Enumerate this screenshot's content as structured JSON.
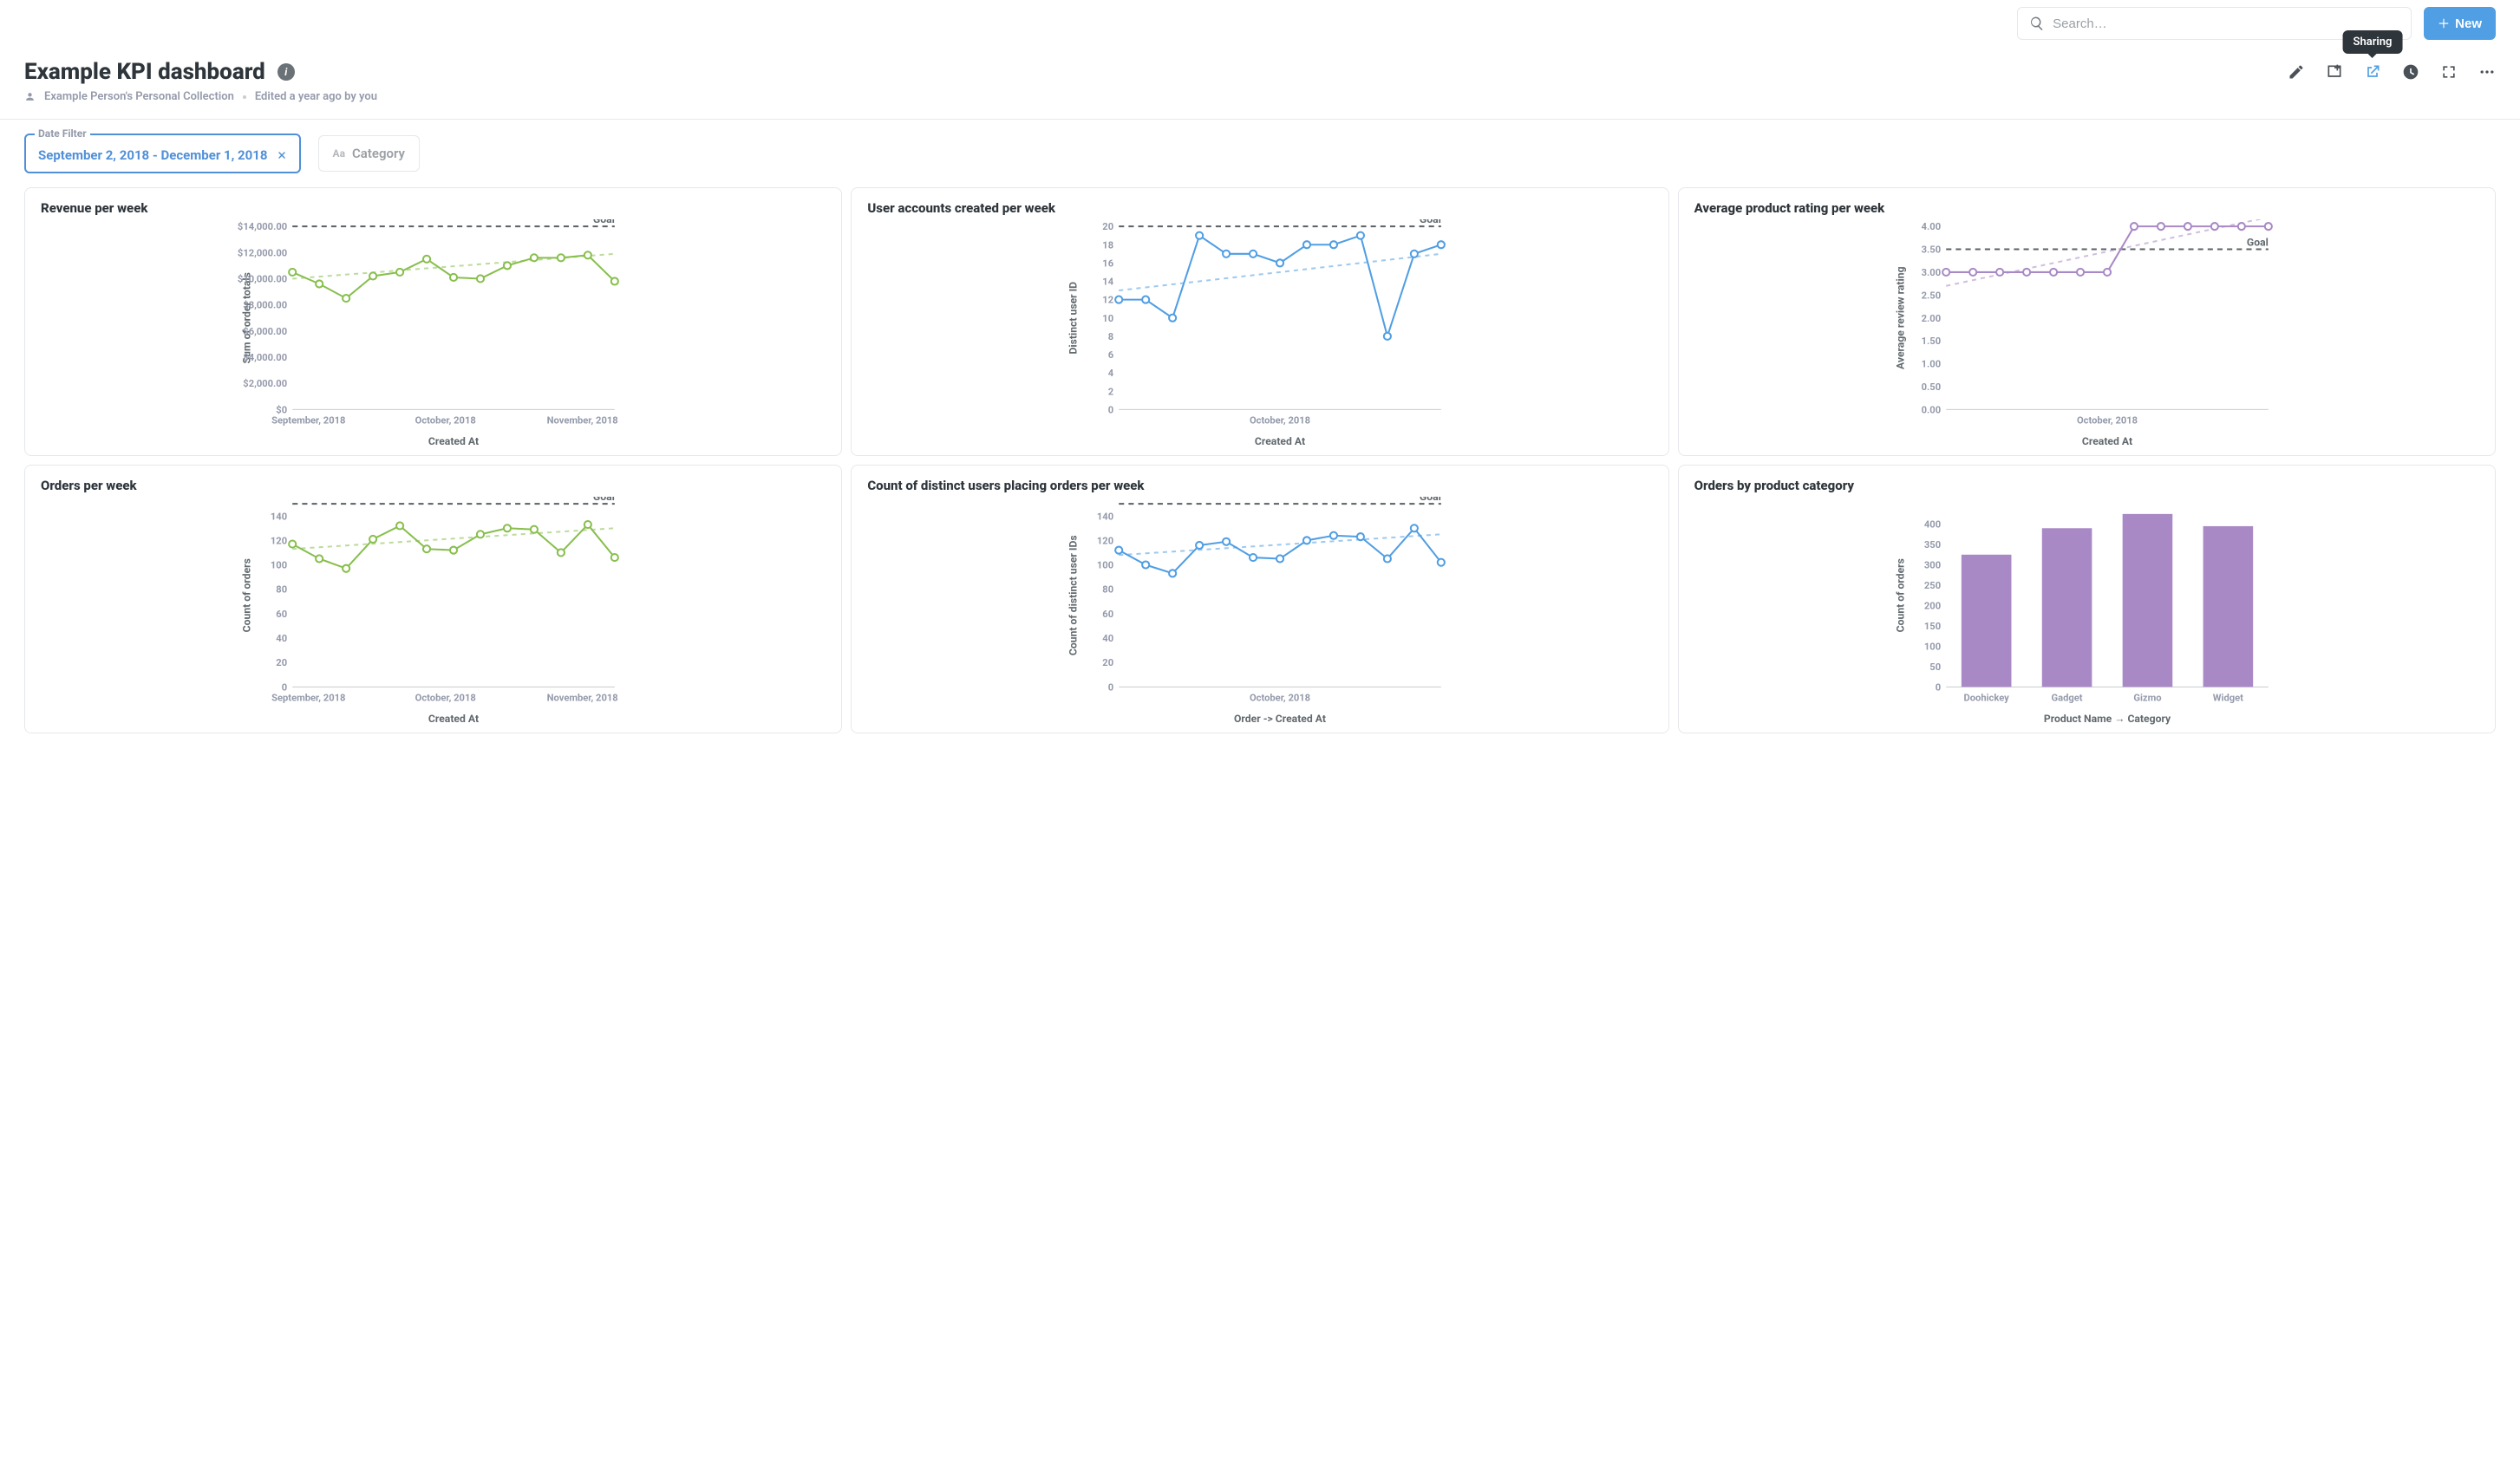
{
  "topbar": {
    "search_placeholder": "Search…",
    "new_label": "New"
  },
  "header": {
    "title": "Example KPI dashboard",
    "collection": "Example Person's Personal Collection",
    "edited": "Edited a year ago by you",
    "tooltip": "Sharing"
  },
  "filters": {
    "date_legend": "Date Filter",
    "date_value": "September 2, 2018 - December 1, 2018",
    "category_label": "Category"
  },
  "cards": [
    {
      "title": "Revenue per week",
      "xlabel": "Created At",
      "ylabel": "Sum of order totals",
      "goal": "Goal"
    },
    {
      "title": "User accounts created per week",
      "xlabel": "Created At",
      "ylabel": "Distinct user ID",
      "goal": "Goal"
    },
    {
      "title": "Average product rating per week",
      "xlabel": "Created At",
      "ylabel": "Average review rating",
      "goal": "Goal"
    },
    {
      "title": "Orders per week",
      "xlabel": "Created At",
      "ylabel": "Count of orders",
      "goal": "Goal"
    },
    {
      "title": "Count of distinct users placing orders per week",
      "xlabel": "Order -> Created At",
      "ylabel": "Count of distinct user IDs",
      "goal": "Goal"
    },
    {
      "title": "Orders by product category",
      "xlabel": "Product Name → Category",
      "ylabel": "Count of orders"
    }
  ],
  "chart_data": [
    {
      "type": "line",
      "color": "#88bf4d",
      "title": "Revenue per week",
      "xlabel": "Created At",
      "ylabel": "Sum of order totals",
      "ylim": [
        0,
        14000
      ],
      "goal": 14000,
      "yticks": [
        0,
        2000,
        4000,
        6000,
        8000,
        10000,
        12000,
        14000
      ],
      "ytick_labels": [
        "$0",
        "$2,000.00",
        "$4,000.00",
        "$6,000.00",
        "$8,000.00",
        "$10,000.00",
        "$12,000.00",
        "$14,000.00"
      ],
      "xticks": [
        "September, 2018",
        "October, 2018",
        "November, 2018"
      ],
      "x": [
        0,
        1,
        2,
        3,
        4,
        5,
        6,
        7,
        8,
        9,
        10,
        11,
        12
      ],
      "y": [
        10500,
        9600,
        8500,
        10200,
        10500,
        11500,
        10100,
        10000,
        11000,
        11600,
        11600,
        11800,
        9800
      ],
      "trend": [
        10000,
        11900
      ]
    },
    {
      "type": "line",
      "color": "#509ee3",
      "title": "User accounts created per week",
      "xlabel": "Created At",
      "ylabel": "Distinct user ID",
      "ylim": [
        0,
        20
      ],
      "goal": 20,
      "yticks": [
        0,
        2,
        4,
        6,
        8,
        10,
        12,
        14,
        16,
        18,
        20
      ],
      "ytick_labels": [
        "0",
        "2",
        "4",
        "6",
        "8",
        "10",
        "12",
        "14",
        "16",
        "18",
        "20"
      ],
      "xticks": [
        "October, 2018"
      ],
      "x": [
        0,
        1,
        2,
        3,
        4,
        5,
        6,
        7,
        8,
        9,
        10,
        11,
        12
      ],
      "y": [
        12,
        12,
        10,
        19,
        17,
        17,
        16,
        18,
        18,
        19,
        8,
        17,
        18
      ],
      "trend": [
        13,
        17
      ]
    },
    {
      "type": "line",
      "color": "#a989c5",
      "title": "Average product rating per week",
      "xlabel": "Created At",
      "ylabel": "Average review rating",
      "ylim": [
        0,
        4.0
      ],
      "goal": 3.5,
      "yticks": [
        0,
        0.5,
        1.0,
        1.5,
        2.0,
        2.5,
        3.0,
        3.5,
        4.0
      ],
      "ytick_labels": [
        "0.00",
        "0.50",
        "1.00",
        "1.50",
        "2.00",
        "2.50",
        "3.00",
        "3.50",
        "4.00"
      ],
      "xticks": [
        "October, 2018"
      ],
      "x": [
        0,
        1,
        2,
        3,
        4,
        5,
        6,
        7,
        8,
        9,
        10,
        11,
        12
      ],
      "y": [
        3.0,
        3.0,
        3.0,
        3.0,
        3.0,
        3.0,
        3.0,
        4.0,
        4.0,
        4.0,
        4.0,
        4.0,
        4.0
      ],
      "trend": [
        2.7,
        4.2
      ]
    },
    {
      "type": "line",
      "color": "#88bf4d",
      "title": "Orders per week",
      "xlabel": "Created At",
      "ylabel": "Count of orders",
      "ylim": [
        0,
        150
      ],
      "goal": 150,
      "yticks": [
        0,
        20,
        40,
        60,
        80,
        100,
        120,
        140
      ],
      "ytick_labels": [
        "0",
        "20",
        "40",
        "60",
        "80",
        "100",
        "120",
        "140"
      ],
      "xticks": [
        "September, 2018",
        "October, 2018",
        "November, 2018"
      ],
      "x": [
        0,
        1,
        2,
        3,
        4,
        5,
        6,
        7,
        8,
        9,
        10,
        11,
        12
      ],
      "y": [
        117,
        105,
        97,
        121,
        132,
        113,
        112,
        125,
        130,
        129,
        110,
        133,
        106
      ],
      "trend": [
        113,
        130
      ]
    },
    {
      "type": "line",
      "color": "#509ee3",
      "title": "Count of distinct users placing orders per week",
      "xlabel": "Order -> Created At",
      "ylabel": "Count of distinct user IDs",
      "ylim": [
        0,
        150
      ],
      "goal": 150,
      "yticks": [
        0,
        20,
        40,
        60,
        80,
        100,
        120,
        140
      ],
      "ytick_labels": [
        "0",
        "20",
        "40",
        "60",
        "80",
        "100",
        "120",
        "140"
      ],
      "xticks": [
        "October, 2018"
      ],
      "x": [
        0,
        1,
        2,
        3,
        4,
        5,
        6,
        7,
        8,
        9,
        10,
        11,
        12
      ],
      "y": [
        112,
        100,
        93,
        116,
        119,
        106,
        105,
        120,
        124,
        123,
        105,
        130,
        102
      ],
      "trend": [
        108,
        125
      ]
    },
    {
      "type": "bar",
      "color": "#a989c5",
      "title": "Orders by product category",
      "xlabel": "Product Name → Category",
      "ylabel": "Count of orders",
      "ylim": [
        0,
        450
      ],
      "yticks": [
        0,
        50,
        100,
        150,
        200,
        250,
        300,
        350,
        400
      ],
      "ytick_labels": [
        "0",
        "50",
        "100",
        "150",
        "200",
        "250",
        "300",
        "350",
        "400"
      ],
      "categories": [
        "Doohickey",
        "Gadget",
        "Gizmo",
        "Widget"
      ],
      "values": [
        325,
        390,
        425,
        395
      ]
    }
  ]
}
